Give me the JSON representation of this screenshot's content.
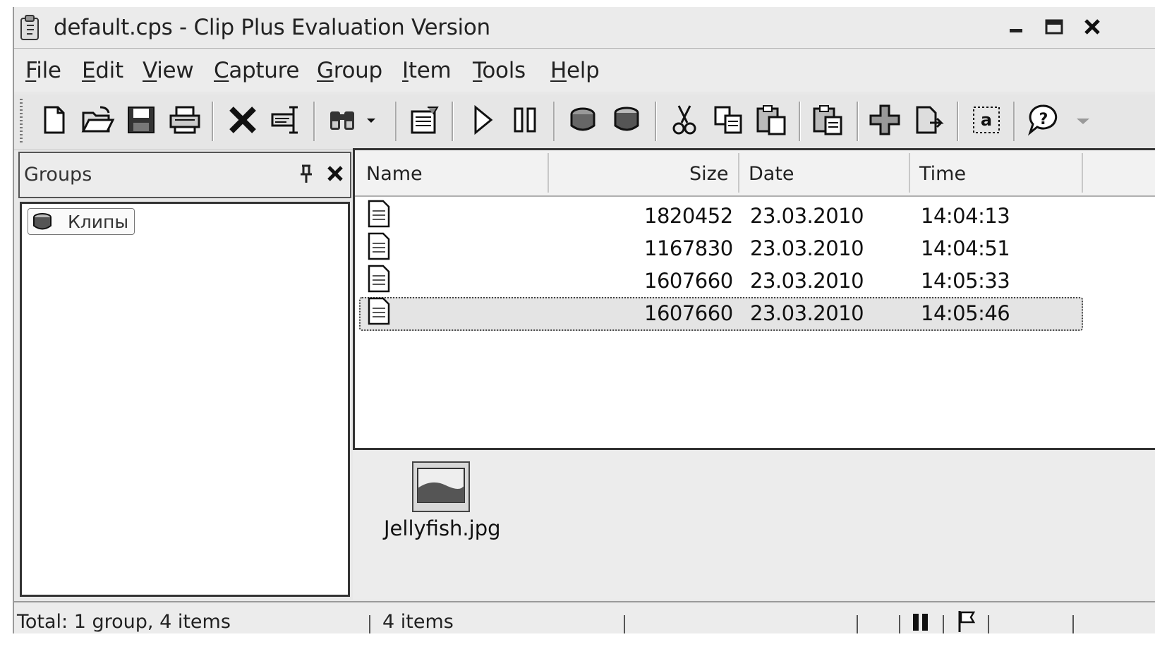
{
  "window": {
    "title": "default.cps - Clip Plus Evaluation Version",
    "controls": [
      "minimize-icon",
      "maximize-icon",
      "close-icon"
    ]
  },
  "menu": [
    "File",
    "Edit",
    "View",
    "Capture",
    "Group",
    "Item",
    "Tools",
    "Help"
  ],
  "menu_accel": [
    "F",
    "E",
    "V",
    "C",
    "G",
    "I",
    "T",
    "H"
  ],
  "toolbar": {
    "buttons": [
      "new-icon",
      "open-icon",
      "save-icon",
      "print-icon",
      "delete-icon",
      "rename-icon",
      "find-icon",
      "dropdown-arrow-icon",
      "properties-icon",
      "play-icon",
      "pause-icon",
      "group-open-icon",
      "group-close-icon",
      "cut-icon",
      "copy-icon",
      "paste-icon",
      "paste-special-icon",
      "add-icon",
      "export-icon",
      "text-icon",
      "help-icon",
      "overflow-icon"
    ]
  },
  "groups": {
    "title": "Groups",
    "items": [
      {
        "label": "Клипы",
        "icon": "clip-group-icon"
      }
    ]
  },
  "list": {
    "columns": [
      "Name",
      "Size",
      "Date",
      "Time"
    ],
    "rows": [
      {
        "name": "",
        "size": "1820452",
        "date": "23.03.2010",
        "time": "14:04:13",
        "selected": false
      },
      {
        "name": "",
        "size": "1167830",
        "date": "23.03.2010",
        "time": "14:04:51",
        "selected": false
      },
      {
        "name": "",
        "size": "1607660",
        "date": "23.03.2010",
        "time": "14:05:33",
        "selected": false
      },
      {
        "name": "",
        "size": "1607660",
        "date": "23.03.2010",
        "time": "14:05:46",
        "selected": true
      }
    ]
  },
  "preview": {
    "filename": "Jellyfish.jpg"
  },
  "status": {
    "total": "Total: 1 group, 4 items",
    "items": "4 items"
  }
}
